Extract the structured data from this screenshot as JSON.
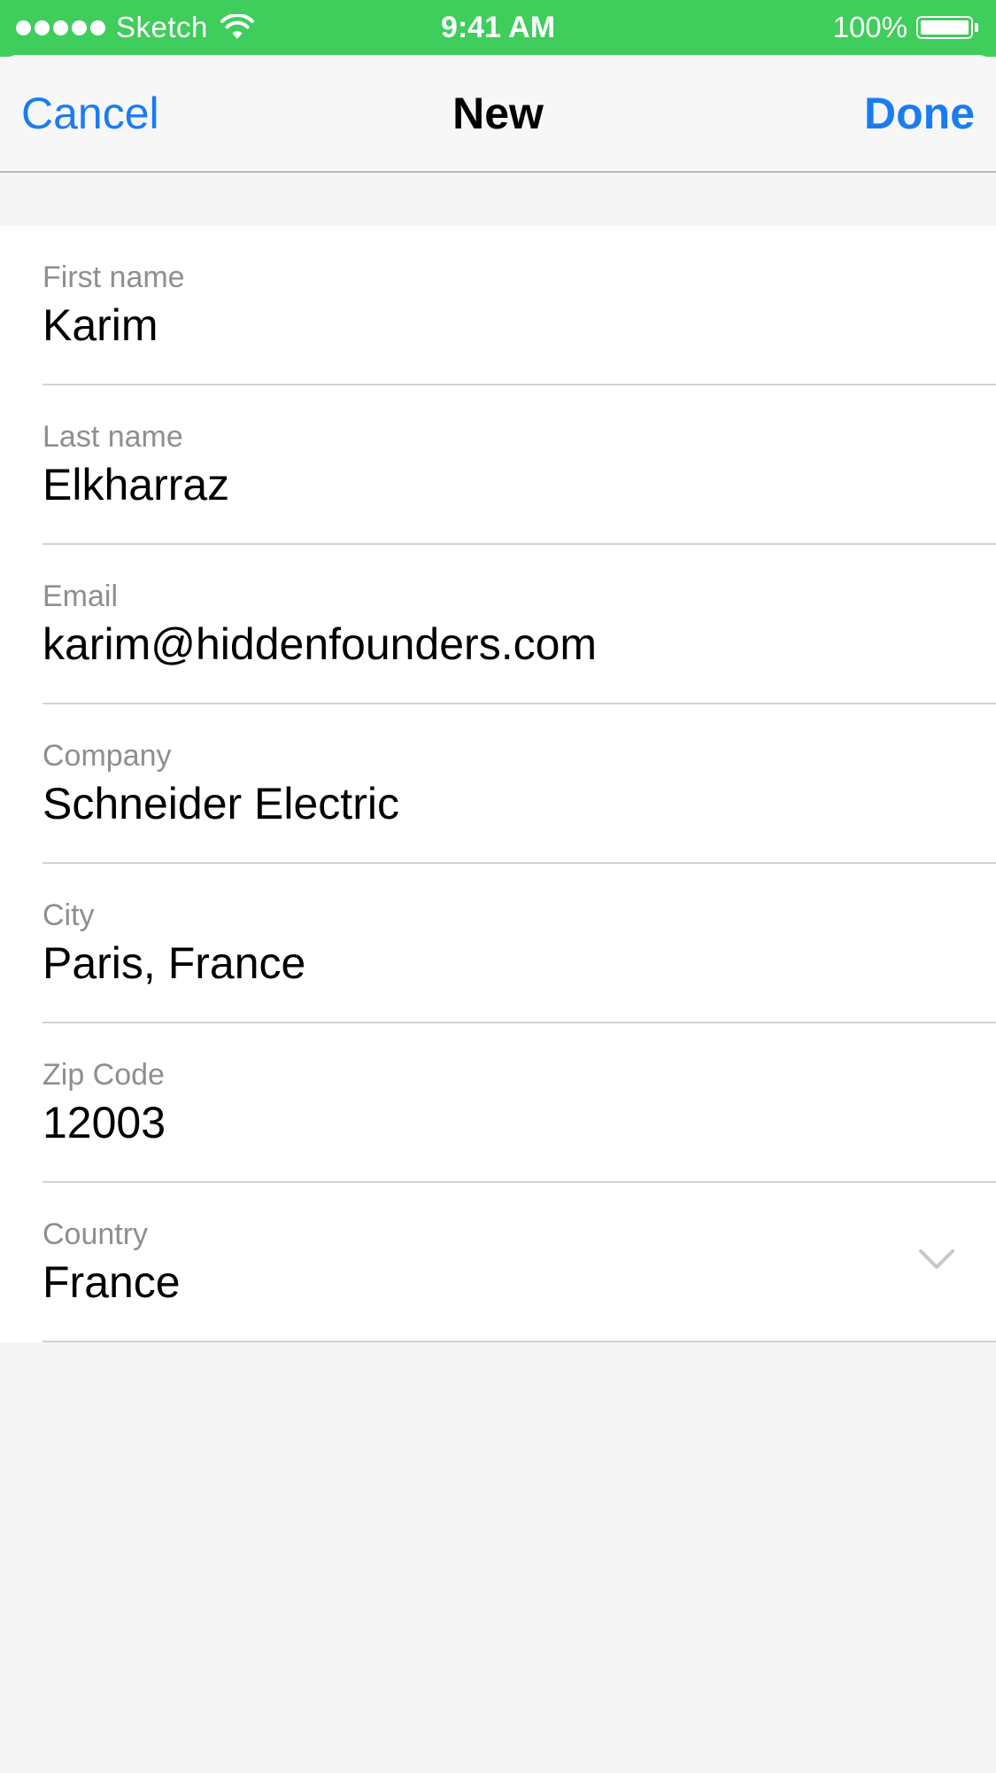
{
  "status_bar": {
    "carrier": "Sketch",
    "time": "9:41 AM",
    "battery": "100%",
    "battery_level": 1.0,
    "signal_icon": "signal-dots-icon",
    "wifi_icon": "wifi-icon",
    "battery_icon": "battery-icon"
  },
  "nav": {
    "cancel_label": "Cancel",
    "title": "New",
    "done_label": "Done"
  },
  "form": {
    "fields": [
      {
        "label": "First name",
        "value": "Karim"
      },
      {
        "label": "Last name",
        "value": "Elkharraz"
      },
      {
        "label": "Email",
        "value": "karim@hiddenfounders.com"
      },
      {
        "label": "Company",
        "value": "Schneider Electric"
      },
      {
        "label": "City",
        "value": "Paris, France"
      },
      {
        "label": "Zip Code",
        "value": "12003"
      },
      {
        "label": "Country",
        "value": "France",
        "icon": "chevron-down-icon"
      }
    ]
  },
  "colors": {
    "status_bar": "#3fcd5b",
    "accent": "#1a7cf2",
    "label": "#8e8e93",
    "background": "#f5f5f5"
  }
}
